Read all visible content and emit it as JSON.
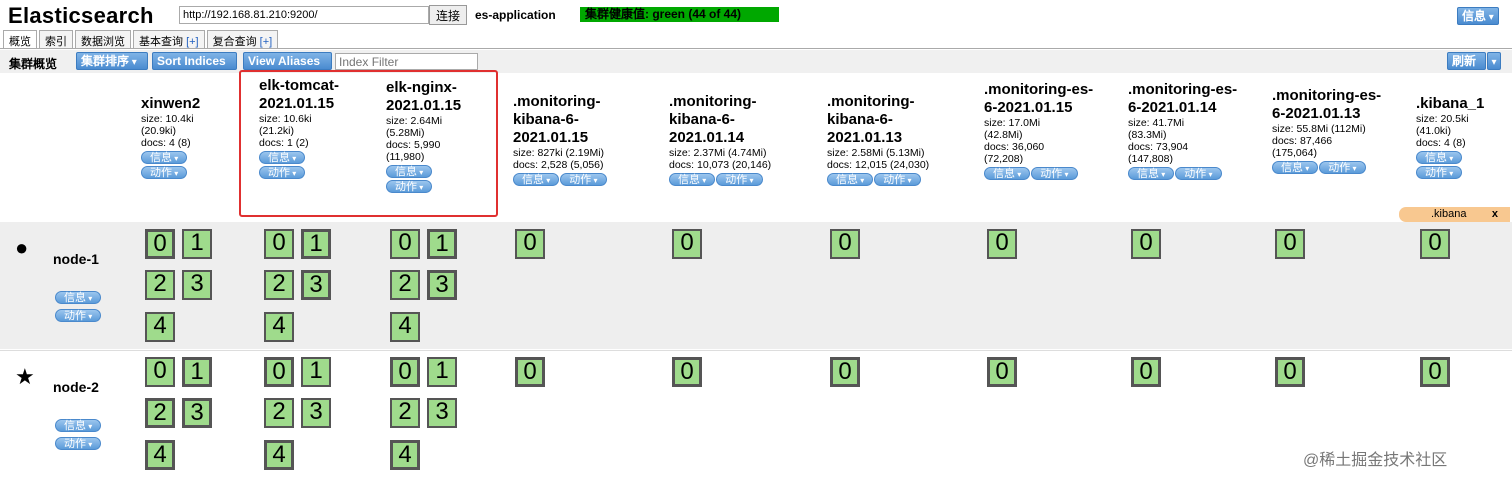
{
  "header": {
    "title": "Elasticsearch",
    "url_value": "http://192.168.81.210:9200/",
    "connect_label": "连接",
    "cluster_name": "es-application",
    "health": "集群健康值: green (44 of 44)",
    "info_label": "信息"
  },
  "tabs": [
    {
      "label": "概览",
      "plus": ""
    },
    {
      "label": "索引",
      "plus": ""
    },
    {
      "label": "数据浏览",
      "plus": ""
    },
    {
      "label": "基本查询",
      "plus": "[+]"
    },
    {
      "label": "复合查询",
      "plus": "[+]"
    }
  ],
  "toolbar": {
    "overview_label": "集群概览",
    "cluster_sort": "集群排序",
    "sort_indices": "Sort Indices",
    "view_aliases": "View Aliases",
    "index_filter_placeholder": "Index Filter",
    "refresh": "刷新"
  },
  "buttons": {
    "info": "信息",
    "action": "动作"
  },
  "indices": [
    {
      "name": "xinwen2",
      "size": "size: 10.4ki",
      "size2": "(20.9ki)",
      "docs": "docs: 4 (8)",
      "docs2": ""
    },
    {
      "name": "elk-tomcat-2021.01.15",
      "size": "size: 10.6ki",
      "size2": "(21.2ki)",
      "docs": "docs: 1 (2)",
      "docs2": ""
    },
    {
      "name": "elk-nginx-2021.01.15",
      "size": "size: 2.64Mi",
      "size2": "(5.28Mi)",
      "docs": "docs: 5,990",
      "docs2": "(11,980)"
    },
    {
      "name": ".monitoring-kibana-6-2021.01.15",
      "size": "size: 827ki (2.19Mi)",
      "size2": "",
      "docs": "docs: 2,528 (5,056)",
      "docs2": ""
    },
    {
      "name": ".monitoring-kibana-6-2021.01.14",
      "size": "size: 2.37Mi (4.74Mi)",
      "size2": "",
      "docs": "docs: 10,073 (20,146)",
      "docs2": ""
    },
    {
      "name": ".monitoring-kibana-6-2021.01.13",
      "size": "size: 2.58Mi (5.13Mi)",
      "size2": "",
      "docs": "docs: 12,015 (24,030)",
      "docs2": ""
    },
    {
      "name": ".monitoring-es-6-2021.01.15",
      "size": "size: 17.0Mi",
      "size2": "(42.8Mi)",
      "docs": "docs: 36,060",
      "docs2": "(72,208)"
    },
    {
      "name": ".monitoring-es-6-2021.01.14",
      "size": "size: 41.7Mi",
      "size2": "(83.3Mi)",
      "docs": "docs: 73,904",
      "docs2": "(147,808)"
    },
    {
      "name": ".monitoring-es-6-2021.01.13",
      "size": "size: 55.8Mi (112Mi)",
      "size2": "",
      "docs": "docs: 87,466",
      "docs2": "(175,064)"
    },
    {
      "name": ".kibana_1",
      "size": "size: 20.5ki",
      "size2": "(41.0ki)",
      "docs": "docs: 4 (8)",
      "docs2": ""
    }
  ],
  "alias": {
    "name": ".kibana",
    "close": "x"
  },
  "nodes": [
    {
      "name": "node-1",
      "marker": "●"
    },
    {
      "name": "node-2",
      "marker": "★"
    }
  ],
  "shards": {
    "s0": "0",
    "s1": "1",
    "s2": "2",
    "s3": "3",
    "s4": "4"
  },
  "watermark": "@稀土掘金技术社区"
}
